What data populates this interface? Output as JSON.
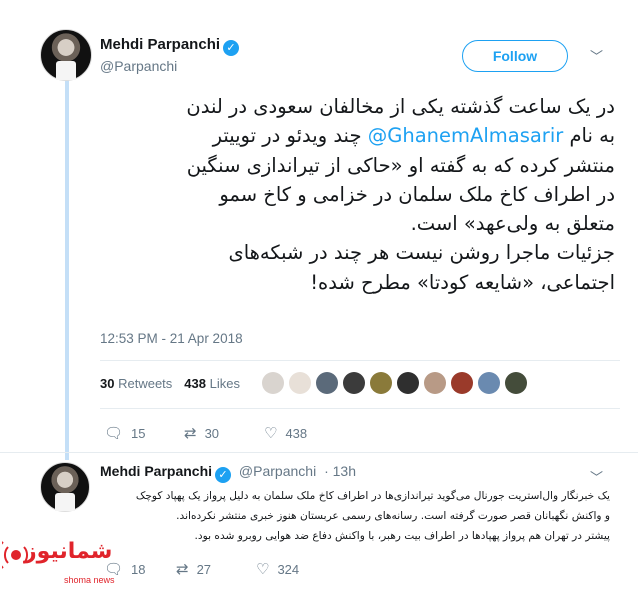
{
  "tweet": {
    "name": "Mehdi Parpanchi",
    "handle": "@Parpanchi",
    "follow_label": "Follow",
    "text_lines": [
      "در یک ساعت گذشته یکی از مخالفان سعودی در لندن",
      "چند ویدئو در توییتر",
      "منتشر کرده که به گفته او «حاکی از تیراندازی سنگین",
      "در اطراف کاخ ملک سلمان در خزامی و کاخ سمو",
      "متعلق به ولی‌عهد» است.",
      "جزئیات ماجرا روشن نیست هر چند در شبکه‌های",
      "اجتماعی، «شایعه کودتا» مطرح شده!"
    ],
    "line2_prefix": "به نام",
    "mention": "@GhanemAlmasarir",
    "timestamp": "12:53 PM - 21 Apr 2018",
    "retweets_count": "30",
    "retweets_label": "Retweets",
    "likes_count": "438",
    "likes_label": "Likes",
    "actions": {
      "replies": "15",
      "retweets": "30",
      "likes": "438"
    }
  },
  "reply": {
    "name": "Mehdi Parpanchi",
    "handle": "@Parpanchi",
    "time": "· 13h",
    "text_lines": [
      "یک خبرنگار وال‌استریت جورنال می‌گوید تیراندازی‌ها در اطراف کاخ ملک سلمان به دلیل پرواز یک پهپاد کوچک",
      "و واکنش نگهبانان قصر صورت گرفته است. رسانه‌های رسمی عربستان هنوز خبری منتشر نکرده‌اند.",
      "پیشتر در تهران هم پرواز پهپادها در اطراف بیت رهبر،  با واکنش دفاع ضد هوایی روبرو شده بود."
    ],
    "actions": {
      "replies": "18",
      "retweets": "27",
      "likes": "324"
    }
  },
  "watermark": {
    "main": "شمانیوز",
    "sub": "shoma news"
  },
  "colors": {
    "accent": "#1da1f2",
    "like": "#657786",
    "thread": "#c4dff7",
    "watermark": "#e0242b"
  },
  "icons": [
    "verified-badge",
    "chevron-down-icon",
    "reply-icon",
    "retweet-icon",
    "like-icon"
  ]
}
